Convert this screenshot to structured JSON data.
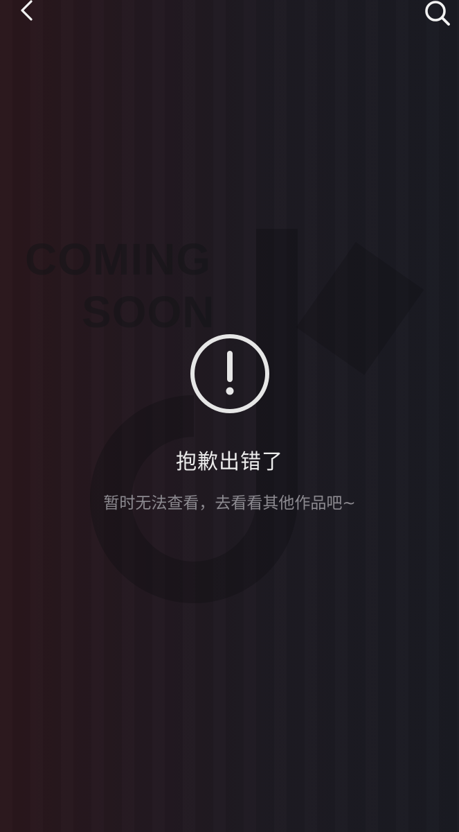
{
  "topbar": {
    "back_icon": "chevron-left-icon",
    "search_icon": "search-icon"
  },
  "background": {
    "poster_line1": "COMING",
    "poster_line2": "SOON"
  },
  "error": {
    "icon": "exclamation-circle-icon",
    "title": "抱歉出错了",
    "subtitle": "暂时无法查看，去看看其他作品吧~"
  },
  "colors": {
    "text_primary": "#ececec",
    "text_secondary": "#8c8a90",
    "icon": "#e6e6e6"
  }
}
